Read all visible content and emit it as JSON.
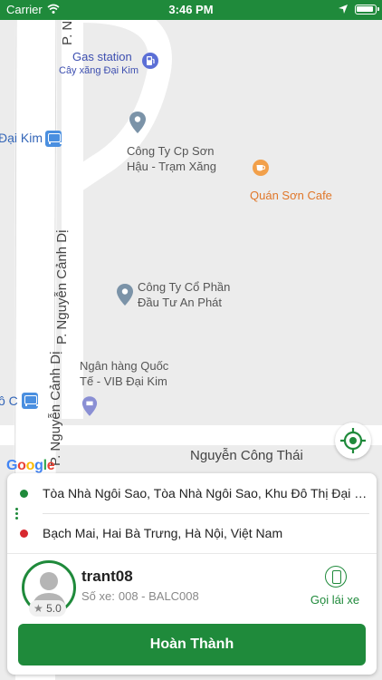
{
  "status_bar": {
    "carrier": "Carrier",
    "time": "3:46 PM"
  },
  "map": {
    "labels": {
      "street_top": "P. Ng",
      "gas_station": "Gas station",
      "gas_station_sub": "Cây xăng Đại Kim",
      "dai_kim": "Đại Kim",
      "cong_ty_son_hau_1": "Công Ty Cp Sơn",
      "cong_ty_son_hau_2": "Hậu - Trạm Xăng",
      "quan_son_cafe": "Quán Sơn Cafe",
      "cong_ty_an_phat_1": "Công Ty Cổ Phần",
      "cong_ty_an_phat_2": "Đầu Tư An Phát",
      "street_right": "P. Nguyễn Cảnh Dị",
      "street_left": "P. Nguyễn Cảnh Dị",
      "vib_1": "Ngân hàng Quốc",
      "vib_2": "Tế - VIB Đại Kim",
      "o_c": "ô C",
      "street_bottom": "Nguyễn Công Thái",
      "google": "Google"
    }
  },
  "trip": {
    "pickup": "Tòa Nhà Ngôi Sao, Tòa Nhà Ngôi Sao, Khu Đô Thị Đại Kim",
    "dropoff": "Bạch Mai, Hai Bà Trưng, Hà Nội, Việt Nam"
  },
  "driver": {
    "name": "trant08",
    "plate_label": "Số xe:",
    "plate": "008 - BALC008",
    "rating": "5.0",
    "call_label": "Gọi lái xe"
  },
  "actions": {
    "finish_label": "Hoàn Thành"
  },
  "colors": {
    "accent": "#1f8a3b",
    "pickup_dot": "#1f8a3b",
    "dropoff_dot": "#d7282f"
  }
}
